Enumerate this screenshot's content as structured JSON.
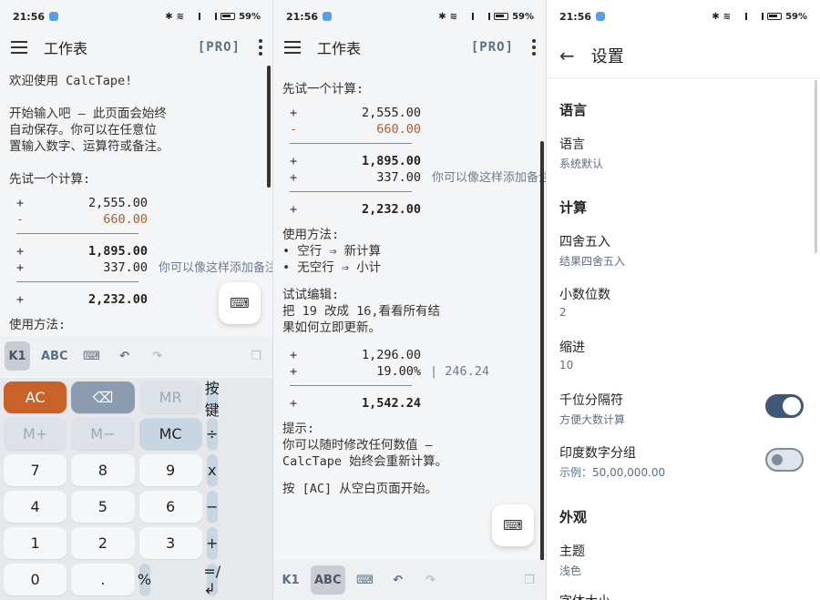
{
  "status": {
    "time": "21:56",
    "icons": [
      "bluetooth-icon",
      "wifi-icon",
      "signal-icon",
      "signal-icon",
      "battery-icon"
    ],
    "battery": "59%"
  },
  "appbar": {
    "title": "工作表",
    "pro_label": "[PRO]"
  },
  "screen1": {
    "welcome": "欢迎使用 CalcTape!",
    "intro": [
      "开始输入吧 — 此页面会始终",
      "自动保存。你可以在任意位",
      "置输入数字、运算符或备注。"
    ],
    "try_calc": "先试一个计算:",
    "rows": [
      {
        "op": "+",
        "value": "2,555.00"
      },
      {
        "op": "-",
        "value": "660.00"
      }
    ],
    "rows2": [
      {
        "op": "+",
        "value": "1,895.00"
      },
      {
        "op": "+",
        "value": "337.00",
        "note": "你可以像这样添加备注"
      }
    ],
    "total": {
      "op": "+",
      "value": "2,232.00"
    },
    "usage_partial": "使用方法:"
  },
  "screen2": {
    "try_calc": "先试一个计算:",
    "rows": [
      {
        "op": "+",
        "value": "2,555.00"
      },
      {
        "op": "-",
        "value": "660.00"
      }
    ],
    "rows2": [
      {
        "op": "+",
        "value": "1,895.00"
      },
      {
        "op": "+",
        "value": "337.00",
        "note": "你可以像这样添加备注"
      }
    ],
    "total": {
      "op": "+",
      "value": "2,232.00"
    },
    "usage_title": "使用方法:",
    "usage": [
      "• 空行 ⇒ 新计算",
      "• 无空行 ⇒ 小计"
    ],
    "edit_title": "试试编辑:",
    "edit_text": [
      "把 19 改成 16,看看所有结",
      "果如何立即更新。"
    ],
    "rows3": [
      {
        "op": "+",
        "value": "1,296.00"
      },
      {
        "op": "+",
        "value": "19.00%",
        "extra": "| 246.24"
      }
    ],
    "total2": {
      "op": "+",
      "value": "1,542.24"
    },
    "tip_title": "提示:",
    "tip": [
      "你可以随时修改任何数值 —",
      "CalcTape 始终会重新计算。"
    ],
    "reset": "按 [AC] 从空白页面开始。"
  },
  "toolbar": {
    "k1": "K1",
    "abc": "ABC",
    "icons": [
      "keyboard-icon",
      "undo-icon",
      "redo-icon",
      "copy-icon"
    ]
  },
  "keypad": [
    {
      "label": "AC",
      "kind": "ac"
    },
    {
      "label": "⌫",
      "kind": "del"
    },
    {
      "label": "MR",
      "kind": "dis"
    },
    {
      "label": "按键",
      "kind": "op"
    },
    {
      "label": "M+",
      "kind": "dis"
    },
    {
      "label": "M−",
      "kind": "dis"
    },
    {
      "label": "MC",
      "kind": "mc"
    },
    {
      "label": "÷",
      "kind": "op"
    },
    {
      "label": "7",
      "kind": "num"
    },
    {
      "label": "8",
      "kind": "num"
    },
    {
      "label": "9",
      "kind": "num"
    },
    {
      "label": "x",
      "kind": "op"
    },
    {
      "label": "4",
      "kind": "num"
    },
    {
      "label": "5",
      "kind": "num"
    },
    {
      "label": "6",
      "kind": "num"
    },
    {
      "label": "−",
      "kind": "op"
    },
    {
      "label": "1",
      "kind": "num"
    },
    {
      "label": "2",
      "kind": "num"
    },
    {
      "label": "3",
      "kind": "num"
    },
    {
      "label": "+",
      "kind": "op"
    },
    {
      "label": "0",
      "kind": "num"
    },
    {
      "label": ".",
      "kind": "num"
    },
    {
      "label": "%",
      "kind": "op"
    },
    {
      "label": "=/↲",
      "kind": "op"
    }
  ],
  "settings": {
    "title": "设置",
    "language_section": "语言",
    "language_title": "语言",
    "language_value": "系统默认",
    "calc_section": "计算",
    "rounding_title": "四舍五入",
    "rounding_value": "结果四舍五入",
    "decimals_title": "小数位数",
    "decimals_value": "2",
    "indent_title": "缩进",
    "indent_value": "10",
    "thousands_title": "千位分隔符",
    "thousands_value": "方便大数计算",
    "thousands_on": true,
    "indian_title": "印度数字分组",
    "indian_value": "示例：50,00,000.00",
    "indian_on": false,
    "appearance_section": "外观",
    "theme_title": "主题",
    "theme_value": "浅色",
    "font_size_partial": "字体大小"
  }
}
